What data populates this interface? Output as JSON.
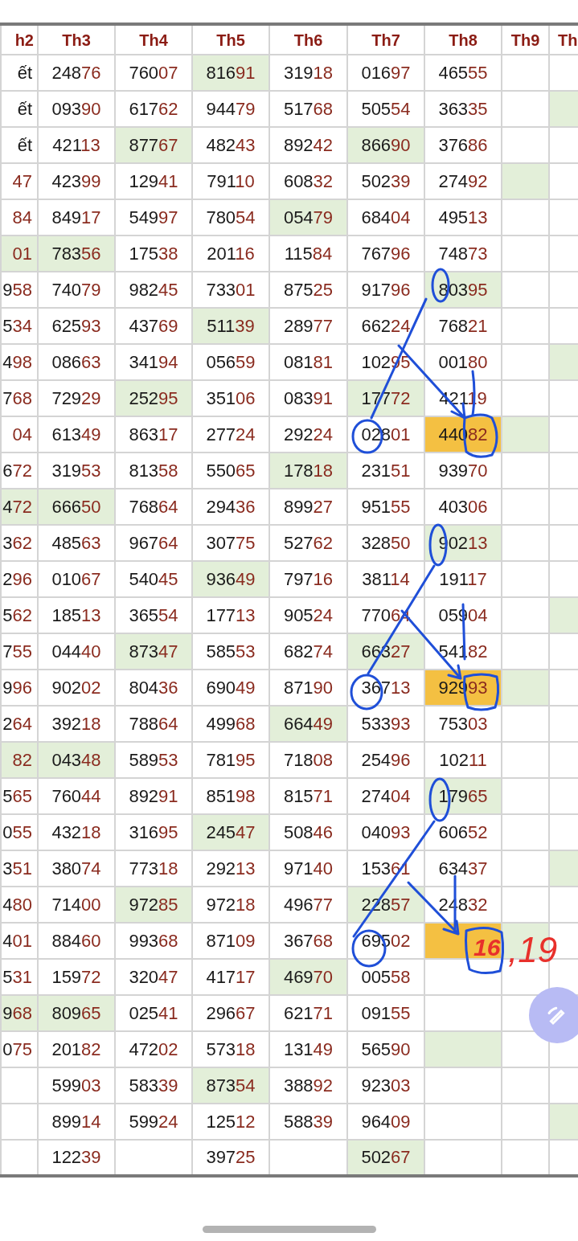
{
  "header": [
    {
      "label": "h2"
    },
    {
      "label": "Th3"
    },
    {
      "label": "Th4"
    },
    {
      "label": "Th5"
    },
    {
      "label": "Th6"
    },
    {
      "label": "Th7"
    },
    {
      "label": "Th8"
    },
    {
      "label": "Th9"
    },
    {
      "label": "Th"
    }
  ],
  "rows": [
    {
      "cells": [
        {
          "head": "ết"
        },
        {
          "head": "248",
          "tail": "76"
        },
        {
          "head": "760",
          "tail": "07"
        },
        {
          "head": "816",
          "tail": "91",
          "color": "#e3efd9"
        },
        {
          "head": "319",
          "tail": "18"
        },
        {
          "head": "016",
          "tail": "97"
        },
        {
          "head": "465",
          "tail": "55"
        }
      ]
    },
    {
      "cells": [
        {
          "head": "ết"
        },
        {
          "head": "093",
          "tail": "90"
        },
        {
          "head": "617",
          "tail": "62"
        },
        {
          "head": "944",
          "tail": "79"
        },
        {
          "head": "517",
          "tail": "68"
        },
        {
          "head": "505",
          "tail": "54"
        },
        {
          "head": "363",
          "tail": "35"
        },
        {},
        {
          "color": "#e3efd9"
        }
      ]
    },
    {
      "cells": [
        {
          "head": "ết"
        },
        {
          "head": "421",
          "tail": "13"
        },
        {
          "head": "877",
          "tail": "67",
          "color": "#e3efd9"
        },
        {
          "head": "482",
          "tail": "43"
        },
        {
          "head": "892",
          "tail": "42"
        },
        {
          "head": "866",
          "tail": "90",
          "color": "#e3efd9"
        },
        {
          "head": "376",
          "tail": "86"
        }
      ]
    },
    {
      "cells": [
        {
          "tail": "47"
        },
        {
          "head": "423",
          "tail": "99"
        },
        {
          "head": "129",
          "tail": "41"
        },
        {
          "head": "791",
          "tail": "10"
        },
        {
          "head": "608",
          "tail": "32"
        },
        {
          "head": "502",
          "tail": "39"
        },
        {
          "head": "274",
          "tail": "92"
        },
        {
          "color": "#e3efd9"
        }
      ]
    },
    {
      "cells": [
        {
          "tail": "84"
        },
        {
          "head": "849",
          "tail": "17"
        },
        {
          "head": "549",
          "tail": "97"
        },
        {
          "head": "780",
          "tail": "54"
        },
        {
          "head": "054",
          "tail": "79",
          "color": "#e3efd9"
        },
        {
          "head": "684",
          "tail": "04"
        },
        {
          "head": "495",
          "tail": "13"
        }
      ]
    },
    {
      "cells": [
        {
          "tail": "01",
          "color": "#e3efd9"
        },
        {
          "head": "783",
          "tail": "56",
          "color": "#e3efd9"
        },
        {
          "head": "175",
          "tail": "38"
        },
        {
          "head": "201",
          "tail": "16"
        },
        {
          "head": "115",
          "tail": "84"
        },
        {
          "head": "767",
          "tail": "96"
        },
        {
          "head": "748",
          "tail": "73"
        }
      ]
    },
    {
      "cells": [
        {
          "head": "9",
          "tail": "58"
        },
        {
          "head": "740",
          "tail": "79"
        },
        {
          "head": "982",
          "tail": "45"
        },
        {
          "head": "733",
          "tail": "01"
        },
        {
          "head": "875",
          "tail": "25"
        },
        {
          "head": "917",
          "tail": "96"
        },
        {
          "head": "803",
          "tail": "95",
          "color": "#e3efd9"
        }
      ]
    },
    {
      "cells": [
        {
          "head": "5",
          "tail": "34"
        },
        {
          "head": "625",
          "tail": "93"
        },
        {
          "head": "437",
          "tail": "69"
        },
        {
          "head": "511",
          "tail": "39",
          "color": "#e3efd9"
        },
        {
          "head": "289",
          "tail": "77"
        },
        {
          "head": "662",
          "tail": "24"
        },
        {
          "head": "768",
          "tail": "21"
        }
      ]
    },
    {
      "cells": [
        {
          "head": "4",
          "tail": "98"
        },
        {
          "head": "086",
          "tail": "63"
        },
        {
          "head": "341",
          "tail": "94"
        },
        {
          "head": "056",
          "tail": "59"
        },
        {
          "head": "081",
          "tail": "81"
        },
        {
          "head": "102",
          "tail": "95"
        },
        {
          "head": "001",
          "tail": "80"
        },
        {},
        {
          "color": "#e3efd9"
        }
      ]
    },
    {
      "cells": [
        {
          "head": "7",
          "tail": "68"
        },
        {
          "head": "729",
          "tail": "29"
        },
        {
          "head": "252",
          "tail": "95",
          "color": "#e3efd9"
        },
        {
          "head": "351",
          "tail": "06"
        },
        {
          "head": "083",
          "tail": "91"
        },
        {
          "head": "177",
          "tail": "72",
          "color": "#e3efd9"
        },
        {
          "head": "421",
          "tail": "19"
        }
      ]
    },
    {
      "cells": [
        {
          "tail": "04"
        },
        {
          "head": "613",
          "tail": "49"
        },
        {
          "head": "863",
          "tail": "17"
        },
        {
          "head": "277",
          "tail": "24"
        },
        {
          "head": "292",
          "tail": "24"
        },
        {
          "head": "028",
          "tail": "01"
        },
        {
          "head": "440",
          "tail": "82",
          "color": "#f4c042"
        },
        {
          "color": "#e3efd9"
        }
      ]
    },
    {
      "cells": [
        {
          "head": "6",
          "tail": "72"
        },
        {
          "head": "319",
          "tail": "53"
        },
        {
          "head": "813",
          "tail": "58"
        },
        {
          "head": "550",
          "tail": "65"
        },
        {
          "head": "178",
          "tail": "18",
          "color": "#e3efd9"
        },
        {
          "head": "231",
          "tail": "51"
        },
        {
          "head": "939",
          "tail": "70"
        }
      ]
    },
    {
      "cells": [
        {
          "head": "4",
          "tail": "72",
          "color": "#e3efd9"
        },
        {
          "head": "666",
          "tail": "50",
          "color": "#e3efd9"
        },
        {
          "head": "768",
          "tail": "64"
        },
        {
          "head": "294",
          "tail": "36"
        },
        {
          "head": "899",
          "tail": "27"
        },
        {
          "head": "951",
          "tail": "55"
        },
        {
          "head": "403",
          "tail": "06"
        }
      ]
    },
    {
      "cells": [
        {
          "head": "3",
          "tail": "62"
        },
        {
          "head": "485",
          "tail": "63"
        },
        {
          "head": "967",
          "tail": "64"
        },
        {
          "head": "307",
          "tail": "75"
        },
        {
          "head": "527",
          "tail": "62"
        },
        {
          "head": "328",
          "tail": "50"
        },
        {
          "head": "902",
          "tail": "13",
          "color": "#e3efd9"
        }
      ]
    },
    {
      "cells": [
        {
          "head": "2",
          "tail": "96"
        },
        {
          "head": "010",
          "tail": "67"
        },
        {
          "head": "540",
          "tail": "45"
        },
        {
          "head": "936",
          "tail": "49",
          "color": "#e3efd9"
        },
        {
          "head": "797",
          "tail": "16"
        },
        {
          "head": "381",
          "tail": "14"
        },
        {
          "head": "191",
          "tail": "17"
        }
      ]
    },
    {
      "cells": [
        {
          "head": "5",
          "tail": "62"
        },
        {
          "head": "185",
          "tail": "13"
        },
        {
          "head": "365",
          "tail": "54"
        },
        {
          "head": "177",
          "tail": "13"
        },
        {
          "head": "905",
          "tail": "24"
        },
        {
          "head": "770",
          "tail": "64"
        },
        {
          "head": "059",
          "tail": "04"
        },
        {},
        {
          "color": "#e3efd9"
        }
      ]
    },
    {
      "cells": [
        {
          "head": "7",
          "tail": "55"
        },
        {
          "head": "044",
          "tail": "40"
        },
        {
          "head": "873",
          "tail": "47",
          "color": "#e3efd9"
        },
        {
          "head": "585",
          "tail": "53"
        },
        {
          "head": "682",
          "tail": "74"
        },
        {
          "head": "663",
          "tail": "27",
          "color": "#e3efd9"
        },
        {
          "head": "541",
          "tail": "82"
        }
      ]
    },
    {
      "cells": [
        {
          "head": "9",
          "tail": "96"
        },
        {
          "head": "902",
          "tail": "02"
        },
        {
          "head": "804",
          "tail": "36"
        },
        {
          "head": "690",
          "tail": "49"
        },
        {
          "head": "871",
          "tail": "90"
        },
        {
          "head": "367",
          "tail": "13"
        },
        {
          "head": "929",
          "tail": "93",
          "color": "#f4c042"
        },
        {
          "color": "#e3efd9"
        }
      ]
    },
    {
      "cells": [
        {
          "head": "2",
          "tail": "64"
        },
        {
          "head": "392",
          "tail": "18"
        },
        {
          "head": "788",
          "tail": "64"
        },
        {
          "head": "499",
          "tail": "68"
        },
        {
          "head": "664",
          "tail": "49",
          "color": "#e3efd9"
        },
        {
          "head": "533",
          "tail": "93"
        },
        {
          "head": "753",
          "tail": "03"
        }
      ]
    },
    {
      "cells": [
        {
          "tail": "82",
          "color": "#e3efd9"
        },
        {
          "head": "043",
          "tail": "48",
          "color": "#e3efd9"
        },
        {
          "head": "589",
          "tail": "53"
        },
        {
          "head": "781",
          "tail": "95"
        },
        {
          "head": "718",
          "tail": "08"
        },
        {
          "head": "254",
          "tail": "96"
        },
        {
          "head": "102",
          "tail": "11"
        }
      ]
    },
    {
      "cells": [
        {
          "head": "5",
          "tail": "65"
        },
        {
          "head": "760",
          "tail": "44"
        },
        {
          "head": "892",
          "tail": "91"
        },
        {
          "head": "851",
          "tail": "98"
        },
        {
          "head": "815",
          "tail": "71"
        },
        {
          "head": "274",
          "tail": "04"
        },
        {
          "head": "179",
          "tail": "65",
          "color": "#e3efd9"
        }
      ]
    },
    {
      "cells": [
        {
          "head": "0",
          "tail": "55"
        },
        {
          "head": "432",
          "tail": "18"
        },
        {
          "head": "316",
          "tail": "95"
        },
        {
          "head": "245",
          "tail": "47",
          "color": "#e3efd9"
        },
        {
          "head": "508",
          "tail": "46"
        },
        {
          "head": "040",
          "tail": "93"
        },
        {
          "head": "606",
          "tail": "52"
        }
      ]
    },
    {
      "cells": [
        {
          "head": "3",
          "tail": "51"
        },
        {
          "head": "380",
          "tail": "74"
        },
        {
          "head": "773",
          "tail": "18"
        },
        {
          "head": "292",
          "tail": "13"
        },
        {
          "head": "971",
          "tail": "40"
        },
        {
          "head": "153",
          "tail": "61"
        },
        {
          "head": "634",
          "tail": "37"
        },
        {},
        {
          "color": "#e3efd9"
        }
      ]
    },
    {
      "cells": [
        {
          "head": "4",
          "tail": "80"
        },
        {
          "head": "714",
          "tail": "00"
        },
        {
          "head": "972",
          "tail": "85",
          "color": "#e3efd9"
        },
        {
          "head": "972",
          "tail": "18"
        },
        {
          "head": "496",
          "tail": "77"
        },
        {
          "head": "228",
          "tail": "57",
          "color": "#e3efd9"
        },
        {
          "head": "248",
          "tail": "32"
        }
      ]
    },
    {
      "cells": [
        {
          "head": "4",
          "tail": "01"
        },
        {
          "head": "884",
          "tail": "60"
        },
        {
          "head": "993",
          "tail": "68"
        },
        {
          "head": "871",
          "tail": "09"
        },
        {
          "head": "367",
          "tail": "68"
        },
        {
          "head": "695",
          "tail": "02"
        },
        {
          "color": "#f4c042"
        },
        {
          "color": "#e3efd9"
        }
      ]
    },
    {
      "cells": [
        {
          "head": "5",
          "tail": "31"
        },
        {
          "head": "159",
          "tail": "72"
        },
        {
          "head": "320",
          "tail": "47"
        },
        {
          "head": "417",
          "tail": "17"
        },
        {
          "head": "469",
          "tail": "70",
          "color": "#e3efd9"
        },
        {
          "head": "005",
          "tail": "58"
        }
      ]
    },
    {
      "cells": [
        {
          "head": "9",
          "tail": "68",
          "color": "#e3efd9"
        },
        {
          "head": "809",
          "tail": "65",
          "color": "#e3efd9"
        },
        {
          "head": "025",
          "tail": "41"
        },
        {
          "head": "296",
          "tail": "67"
        },
        {
          "head": "621",
          "tail": "71"
        },
        {
          "head": "091",
          "tail": "55"
        }
      ]
    },
    {
      "cells": [
        {
          "head": "0",
          "tail": "75"
        },
        {
          "head": "201",
          "tail": "82"
        },
        {
          "head": "472",
          "tail": "02"
        },
        {
          "head": "573",
          "tail": "18"
        },
        {
          "head": "131",
          "tail": "49"
        },
        {
          "head": "565",
          "tail": "90"
        },
        {
          "color": "#e3efd9"
        }
      ]
    },
    {
      "cells": [
        {},
        {
          "head": "599",
          "tail": "03"
        },
        {
          "head": "583",
          "tail": "39"
        },
        {
          "head": "873",
          "tail": "54",
          "color": "#e3efd9"
        },
        {
          "head": "388",
          "tail": "92"
        },
        {
          "head": "923",
          "tail": "03"
        }
      ]
    },
    {
      "cells": [
        {},
        {
          "head": "899",
          "tail": "14"
        },
        {
          "head": "599",
          "tail": "24"
        },
        {
          "head": "125",
          "tail": "12"
        },
        {
          "head": "588",
          "tail": "39"
        },
        {
          "head": "964",
          "tail": "09"
        },
        {},
        {},
        {
          "color": "#e3efd9"
        }
      ]
    },
    {
      "cells": [
        {},
        {
          "head": "122",
          "tail": "39"
        },
        {},
        {
          "head": "397",
          "tail": "25"
        },
        {},
        {
          "head": "502",
          "tail": "67",
          "color": "#e3efd9"
        }
      ]
    }
  ],
  "handwriting": {
    "circled_note": "16",
    "trailing_note": ",19"
  }
}
